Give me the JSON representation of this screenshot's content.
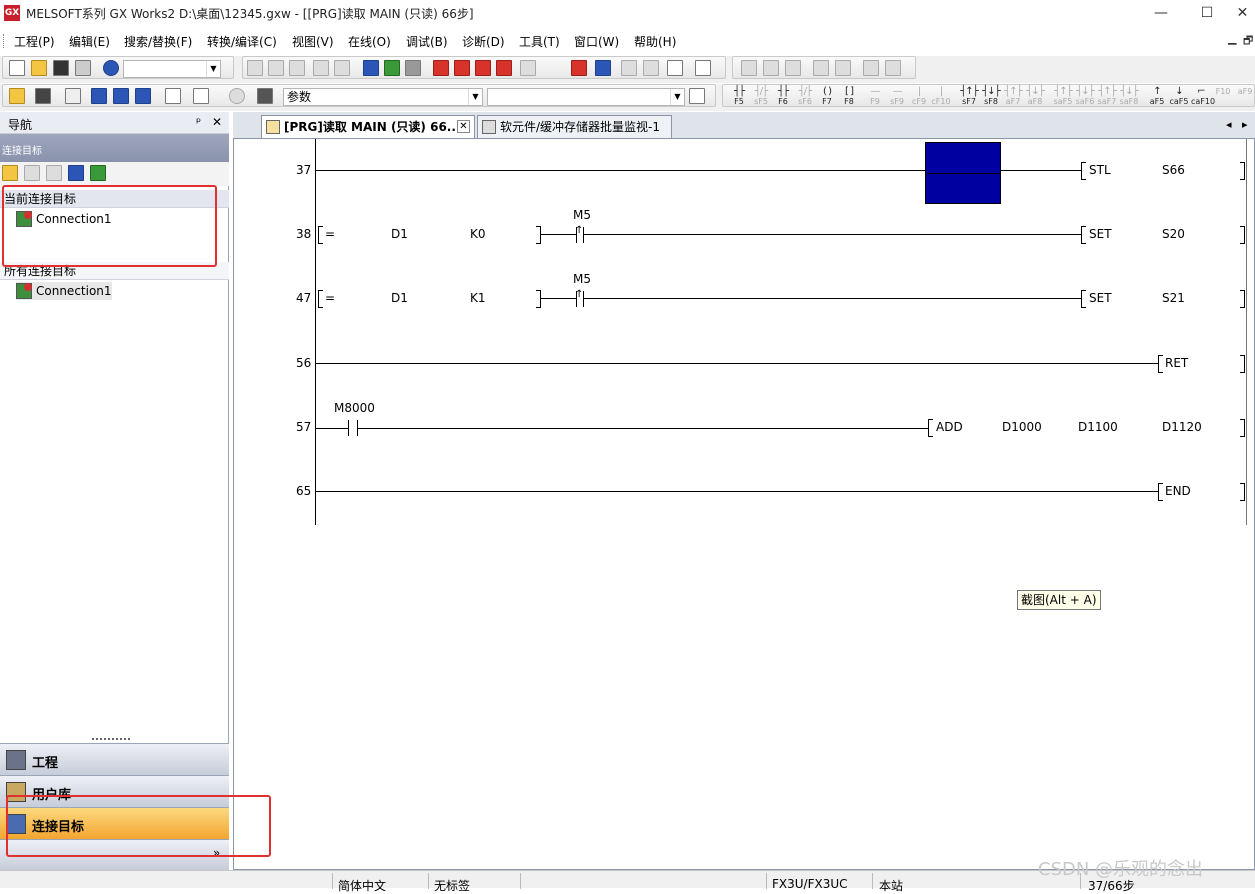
{
  "window": {
    "title": "MELSOFT系列 GX Works2 D:\\桌面\\12345.gxw - [[PRG]读取 MAIN (只读) 66步]",
    "app_icon": "GX",
    "minimize": "—",
    "maximize": "☐",
    "close": "✕"
  },
  "menu": {
    "items": [
      "工程(P)",
      "编辑(E)",
      "搜索/替换(F)",
      "转换/编译(C)",
      "视图(V)",
      "在线(O)",
      "调试(B)",
      "诊断(D)",
      "工具(T)",
      "窗口(W)",
      "帮助(H)"
    ],
    "mdi_min": "▁",
    "mdi_restore": "🗗"
  },
  "toolbar": {
    "search_label": "参数",
    "fkeys": [
      {
        "sym": "┤├",
        "lbl": "F5"
      },
      {
        "sym": "┤/├",
        "lbl": "sF5"
      },
      {
        "sym": "┤├",
        "lbl": "F6"
      },
      {
        "sym": "┤/├",
        "lbl": "sF6"
      },
      {
        "sym": "( )",
        "lbl": "F7"
      },
      {
        "sym": "[ ]",
        "lbl": "F8"
      },
      {
        "sym": "—",
        "lbl": "F9"
      },
      {
        "sym": "—",
        "lbl": "sF9"
      },
      {
        "sym": "|",
        "lbl": "cF9"
      },
      {
        "sym": "|",
        "lbl": "cF10"
      },
      {
        "sym": "┤↑├",
        "lbl": "sF7"
      },
      {
        "sym": "┤↓├",
        "lbl": "sF8"
      },
      {
        "sym": "┤↑├",
        "lbl": "aF7"
      },
      {
        "sym": "┤↓├",
        "lbl": "aF8"
      },
      {
        "sym": "┤↑├",
        "lbl": "saF5"
      },
      {
        "sym": "┤↓├",
        "lbl": "saF6"
      },
      {
        "sym": "┤↑├",
        "lbl": "saF7"
      },
      {
        "sym": "┤↓├",
        "lbl": "saF8"
      },
      {
        "sym": "↑",
        "lbl": "aF5"
      },
      {
        "sym": "↓",
        "lbl": "caF5"
      },
      {
        "sym": "⌐",
        "lbl": "caF10"
      },
      {
        "sym": "",
        "lbl": "F10"
      },
      {
        "sym": "",
        "lbl": "aF9"
      }
    ]
  },
  "nav": {
    "title": "导航",
    "pin": "ᵖ",
    "close": "✕",
    "subtitle": "连接目标",
    "current_group": "当前连接目标",
    "current_item": "Connection1",
    "all_group": "所有连接目标",
    "all_item": "Connection1",
    "panes": [
      "工程",
      "用户库",
      "连接目标"
    ],
    "more": "»"
  },
  "tabs": [
    {
      "label": "[PRG]读取 MAIN (只读) 66...",
      "close": "✕"
    },
    {
      "label": "软元件/缓冲存储器批量监视-1"
    }
  ],
  "tab_scroll": {
    "left": "◂",
    "right": "▸"
  },
  "ladder": {
    "rungs": [
      {
        "step": "37",
        "instr": "STL",
        "op1": "S66"
      },
      {
        "step": "38",
        "cmp": "=",
        "a": "D1",
        "b": "K0",
        "contact": "M5",
        "instr": "SET",
        "op1": "S20"
      },
      {
        "step": "47",
        "cmp": "=",
        "a": "D1",
        "b": "K1",
        "contact": "M5",
        "instr": "SET",
        "op1": "S21"
      },
      {
        "step": "56",
        "instr": "RET"
      },
      {
        "step": "57",
        "contact": "M8000",
        "instr": "ADD",
        "op1": "D1000",
        "op2": "D1100",
        "op3": "D1120"
      },
      {
        "step": "65",
        "instr": "END"
      }
    ],
    "cursor_color": "#0000a0"
  },
  "tooltip": "截图(Alt + A)",
  "status": {
    "language": "简体中文",
    "label": "无标签",
    "cpu": "FX3U/FX3UC",
    "station": "本站",
    "steps": "37/66步"
  },
  "watermark": "CSDN @乐观的念出"
}
